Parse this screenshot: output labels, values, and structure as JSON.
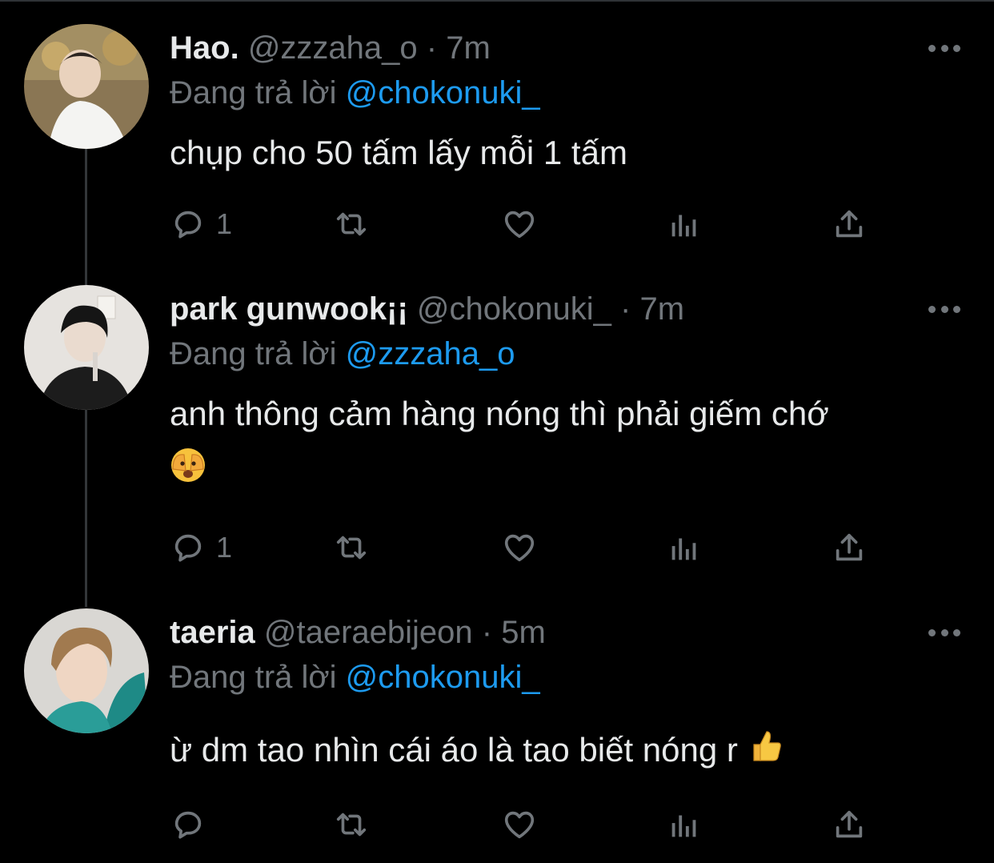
{
  "tweets": [
    {
      "name": "Hao.",
      "handle": "@zzzaha_o",
      "separator": "·",
      "time": "7m",
      "reply_prefix": "Đang trả lời",
      "reply_to": "@chokonuki_",
      "text": "chụp cho 50 tấm lấy mỗi 1 tấm",
      "text_line2": "",
      "reply_count": "1"
    },
    {
      "name": "park gunwook¡¡",
      "handle": "@chokonuki_",
      "separator": "·",
      "time": "7m",
      "reply_prefix": "Đang trả lời",
      "reply_to": "@zzzaha_o",
      "text": "anh thông cảm hàng nóng thì phải giếm chớ",
      "text_line2": "",
      "reply_count": "1"
    },
    {
      "name": "taeria",
      "handle": "@taeraebijeon",
      "separator": "·",
      "time": "5m",
      "reply_prefix": "Đang trả lời",
      "reply_to": "@chokonuki_",
      "text": "ừ dm tao nhìn cái áo là tao biết nóng r",
      "text_line2": "",
      "reply_count": ""
    }
  ],
  "icons": {
    "reply": "reply-icon",
    "retweet": "retweet-icon",
    "like": "heart-icon",
    "views": "analytics-icon",
    "share": "share-icon",
    "more": "more-icon",
    "emoji_tweet2": "face-with-hand-over-eyes-emoji",
    "emoji_tweet3": "thumbs-up-emoji"
  },
  "colors": {
    "background": "#000000",
    "text": "#e7e9ea",
    "secondary": "#71767b",
    "mention": "#1d9bf0",
    "thread_line": "#333639"
  }
}
